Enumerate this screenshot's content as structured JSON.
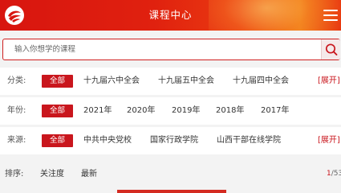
{
  "header": {
    "title": "课程中心",
    "logo_icon": "ribbon-logo-icon",
    "menu_icon": "hamburger-menu-icon"
  },
  "search": {
    "placeholder": "输入你想学的课程",
    "value": "",
    "icon": "search-icon"
  },
  "filters": {
    "category": {
      "label": "分类:",
      "active": "全部",
      "options": [
        "十九届六中全会",
        "十九届五中全会",
        "十九届四中全会"
      ],
      "expand": "[展开]"
    },
    "year": {
      "label": "年份:",
      "active": "全部",
      "options": [
        "2021年",
        "2020年",
        "2019年",
        "2018年",
        "2017年"
      ]
    },
    "source": {
      "label": "来源:",
      "active": "全部",
      "options": [
        "中共中央党校",
        "国家行政学院",
        "山西干部在线学院"
      ],
      "expand": "[展开]"
    }
  },
  "sort": {
    "label": "排序:",
    "options": [
      "关注度",
      "最新"
    ]
  },
  "pagination": {
    "current": "1",
    "total": "/53"
  },
  "colors": {
    "accent": "#c9161d",
    "header": "#e0210f"
  }
}
